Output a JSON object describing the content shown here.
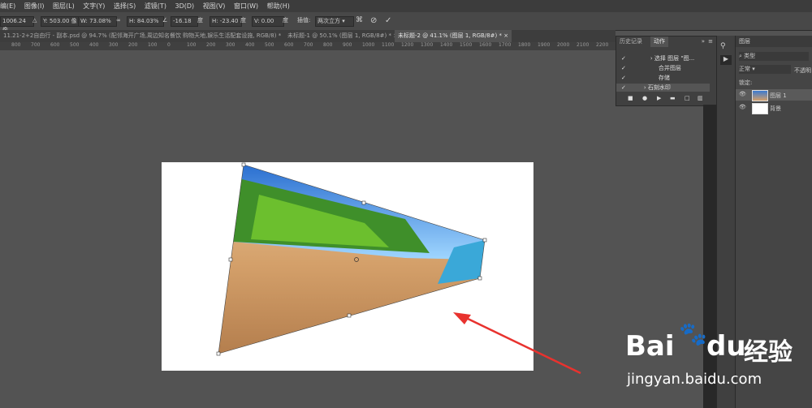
{
  "menubar": {
    "items": [
      "编(E)",
      "图像(I)",
      "图层(L)",
      "文字(Y)",
      "选择(S)",
      "滤镜(T)",
      "3D(D)",
      "视图(V)",
      "窗口(W)",
      "帮助(H)"
    ]
  },
  "options": {
    "x": "1006.24 像",
    "y": "Y: 503.00 像",
    "w": "W: 73.08%",
    "h": "H: 84.03%",
    "angle": "-16.18",
    "angle_unit": "度",
    "hskew": "H: -23.40",
    "hskew_unit": "度",
    "vskew": "V: 0.00",
    "vskew_unit": "度",
    "interp_label": "插值:",
    "interp_value": "两次立方"
  },
  "tabs": [
    {
      "label": "11.21-2+2自由行 - 副本.psd @ 94.7% (配邻海开广场,周边知名餐饮 购物天地,娱乐生活配套设施, RGB/8) *",
      "active": false
    },
    {
      "label": "未标题-1 @ 50.1% (图层 1, RGB/8#) *",
      "active": false
    },
    {
      "label": "未标题-2 @ 41.1% (图层 1, RGB/8#) *",
      "active": true
    }
  ],
  "ruler": [
    "800",
    "700",
    "600",
    "500",
    "400",
    "300",
    "200",
    "100",
    "0",
    "100",
    "200",
    "300",
    "400",
    "500",
    "600",
    "700",
    "800",
    "900",
    "1000",
    "1100",
    "1200",
    "1300",
    "1400",
    "1500",
    "1600",
    "1700",
    "1800",
    "1900",
    "2000",
    "2100",
    "2200"
  ],
  "actions_panel": {
    "tabs": [
      "历史记录",
      "动作"
    ],
    "rows": [
      "选择 图层 \"图...",
      "合并图层",
      "存储",
      "石刻水印"
    ]
  },
  "layers_panel": {
    "tab": "图层",
    "search": "类型",
    "blend": "正常",
    "opacity": "不透明",
    "lock_label": "锁定:",
    "layers": [
      {
        "name": "图层 1"
      },
      {
        "name": "背景"
      }
    ]
  },
  "watermark": {
    "line1": "Bai",
    "line2": "du",
    "line3": "经验",
    "url": "jingyan.baidu.com"
  }
}
